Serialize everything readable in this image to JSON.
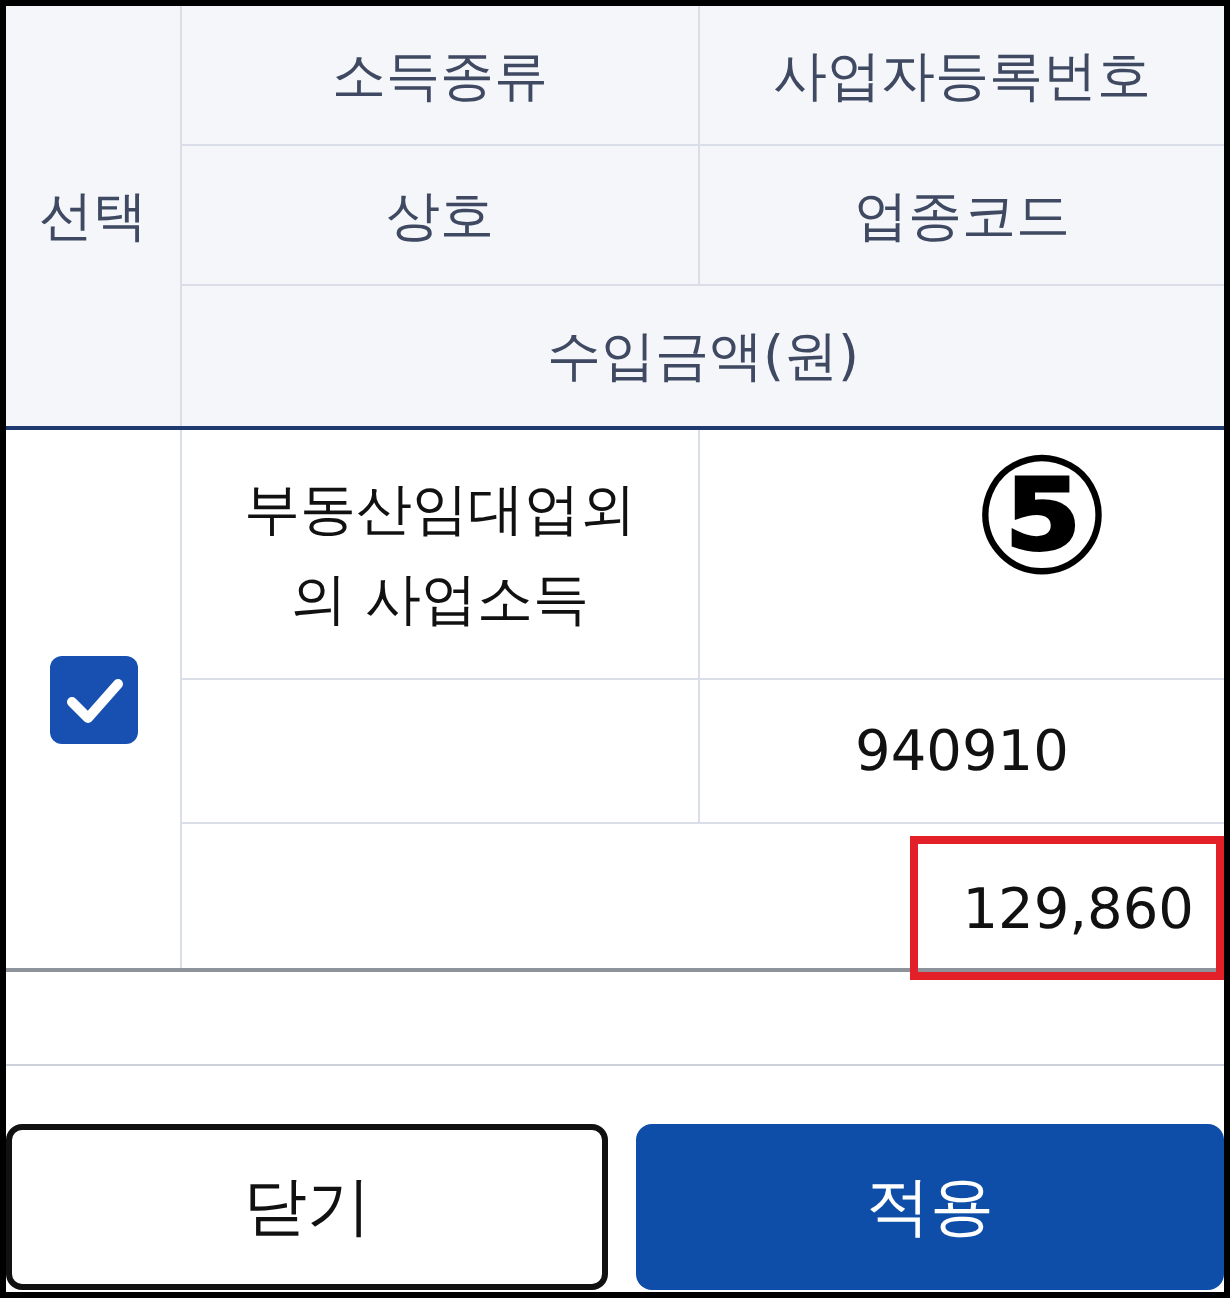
{
  "table": {
    "header": {
      "select": "선택",
      "income_type": "소득종류",
      "business_number": "사업자등록번호",
      "trade_name": "상호",
      "industry_code": "업종코드",
      "income_amount": "수입금액(원)"
    },
    "rows": [
      {
        "checked": true,
        "income_type": "부동산임대업외의 사업소득",
        "industry_code": "940910",
        "amount": "129,860",
        "amount_highlighted": true
      }
    ]
  },
  "annotation_marker": "⑤",
  "buttons": [
    {
      "label": "닫기",
      "kind": "secondary"
    },
    {
      "label": "적용",
      "kind": "primary"
    }
  ]
}
